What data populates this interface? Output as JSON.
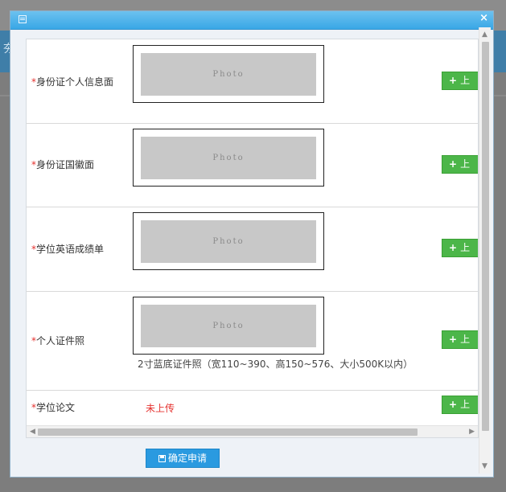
{
  "rows": [
    {
      "label": "身份证个人信息面",
      "required": "*",
      "photo_text": "Photo",
      "button": "上"
    },
    {
      "label": "身份证国徽面",
      "required": "*",
      "photo_text": "Photo",
      "button": "上"
    },
    {
      "label": "学位英语成绩单",
      "required": "*",
      "photo_text": "Photo",
      "button": "上"
    },
    {
      "label": "个人证件照",
      "required": "*",
      "photo_text": "Photo",
      "button": "上",
      "hint": "2寸蓝底证件照（宽110~390、高150~576、大小500K以内）"
    },
    {
      "label": "学位论文",
      "required": "*",
      "status": "未上传",
      "button": "上"
    }
  ],
  "dialog": {
    "close": "×"
  },
  "background": {
    "fragment": "夯"
  },
  "confirm_button": "确定申请",
  "icons": {
    "plus": "+",
    "scroll_up": "▲",
    "scroll_down": "▼",
    "scroll_left": "◀",
    "scroll_right": "▶"
  },
  "colors": {
    "accent": "#39a7e6",
    "upload": "#4cb649",
    "required": "#e5312e",
    "confirm": "#2a9ae0"
  }
}
